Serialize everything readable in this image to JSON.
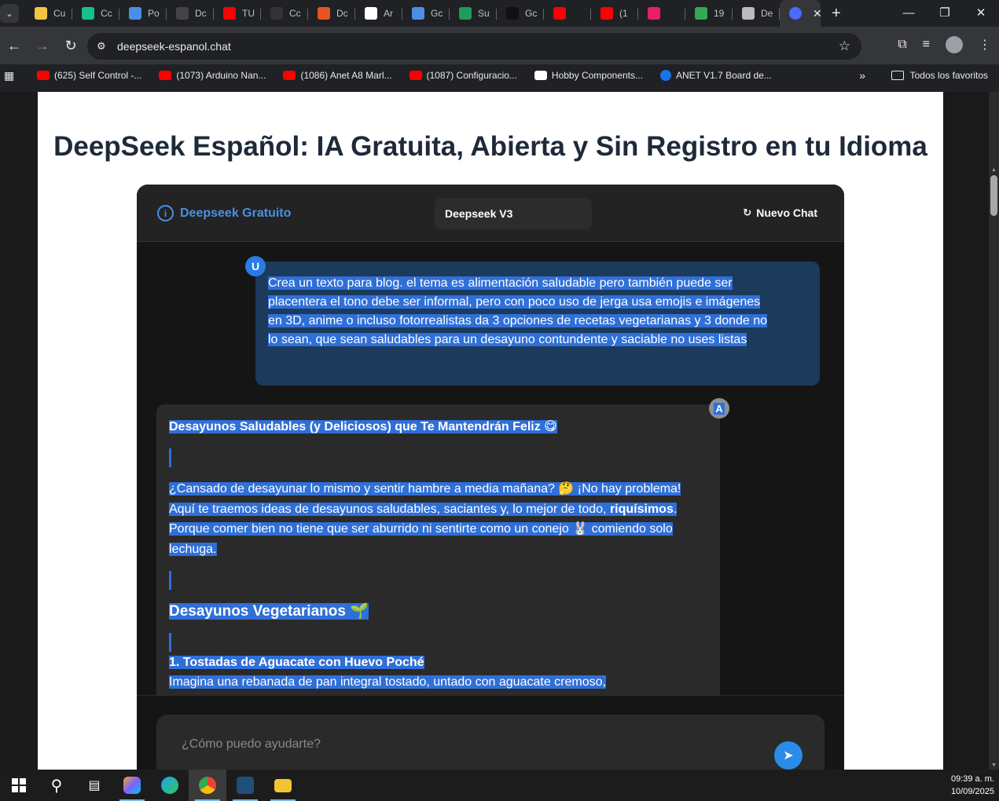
{
  "browser": {
    "tabs": [
      {
        "label": "Cu",
        "color": "#f5c542"
      },
      {
        "label": "Cc",
        "color": "#14c28a"
      },
      {
        "label": "Po",
        "color": "#4a8fe7"
      },
      {
        "label": "Dc",
        "color": "#444444"
      },
      {
        "label": "TU",
        "color": "#ff0000"
      },
      {
        "label": "Cc",
        "color": "#333333"
      },
      {
        "label": "Dc",
        "color": "#e95420"
      },
      {
        "label": "Ar",
        "color": "#ffffff"
      },
      {
        "label": "Gc",
        "color": "#4a8fe7"
      },
      {
        "label": "Su",
        "color": "#1a9e5a"
      },
      {
        "label": "Gc",
        "color": "#111111"
      },
      {
        "label": "",
        "color": "#ff0000"
      },
      {
        "label": "(1",
        "color": "#ff0000"
      },
      {
        "label": "",
        "color": "#e91e63"
      },
      {
        "label": "19",
        "color": "#34a853"
      },
      {
        "label": "De",
        "color": "#bbbbbb"
      }
    ],
    "active_tab_color": "#4b6bfb",
    "address": "deepseek-espanol.chat",
    "bookmarks": [
      {
        "label": "(625) Self Control -...",
        "type": "yt"
      },
      {
        "label": "(1073) Arduino Nan...",
        "type": "yt"
      },
      {
        "label": "(1086) Anet A8 Marl...",
        "type": "yt"
      },
      {
        "label": "(1087) Configuracio...",
        "type": "yt"
      },
      {
        "label": "Hobby Components...",
        "type": "amz"
      },
      {
        "label": "ANET V1.7 Board de...",
        "type": "anet"
      }
    ],
    "bookmarks_folder": "Todos los favoritos"
  },
  "page": {
    "headline": "DeepSeek Español: IA Gratuita, Abierta y Sin Registro en tu Idioma",
    "chat": {
      "brand": "Deepseek Gratuito",
      "model": "Deepseek V3",
      "new_chat": "Nuevo Chat",
      "user_avatar": "U",
      "ai_avatar": "A",
      "user_message_lines": [
        "Crea un texto para blog. el tema es alimentación saludable pero también puede ser",
        "placentera el tono debe ser informal, pero con poco uso de jerga usa emojis e imágenes",
        "en 3D, anime o incluso fotorrealistas da 3 opciones de recetas vegetarianas y 3 donde no",
        "lo sean, que sean saludables para un desayuno contundente y saciable no uses listas"
      ],
      "ai_title": "Desayunos Saludables (y Deliciosos) que Te Mantendrán Feliz 😋",
      "ai_intro_lines": [
        "¿Cansado de desayunar lo mismo y sentir hambre a media mañana? 🤔 ¡No hay problema!",
        "Aquí te traemos ideas de desayunos saludables, saciantes y, lo mejor de todo,",
        "riquísimos",
        "Porque comer bien no tiene que ser aburrido ni sentirte como un conejo 🐰 comiendo solo",
        "lechuga."
      ],
      "ai_section": "Desayunos Vegetarianos 🌱",
      "ai_recipe_title": "1. Tostadas de Aguacate con Huevo Poché",
      "ai_recipe_line": "Imagina una rebanada de pan integral tostado, untado con aguacate cremoso,",
      "input_placeholder": "¿Cómo puedo ayudarte?"
    }
  },
  "taskbar": {
    "time": "09:39 a. m.",
    "date": "10/09/2025"
  }
}
